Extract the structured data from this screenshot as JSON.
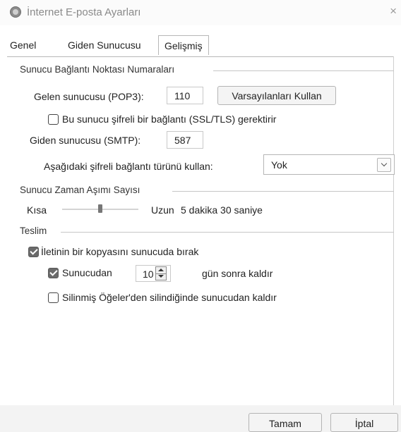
{
  "window": {
    "title": "İnternet E-posta Ayarları",
    "close_glyph": "×"
  },
  "tabs": [
    {
      "label": "Genel",
      "active": false
    },
    {
      "label": "Giden Sunucusu",
      "active": false
    },
    {
      "label": "Gelişmiş",
      "active": true
    }
  ],
  "ports": {
    "group_title": "Sunucu Bağlantı Noktası Numaraları",
    "incoming_label": "Gelen sunucusu (POP3):",
    "incoming_value": "110",
    "defaults_button": "Varsayılanları Kullan",
    "ssl_checkbox_label": "Bu sunucu şifreli bir bağlantı (SSL/TLS) gerektirir",
    "ssl_checked": false,
    "outgoing_label": "Giden sunucusu (SMTP):",
    "outgoing_value": "587",
    "encryption_label": "Aşağıdaki şifreli bağlantı türünü kullan:",
    "encryption_value": "Yok"
  },
  "timeout": {
    "group_title": "Sunucu Zaman Aşımı Sayısı",
    "short_label": "Kısa",
    "long_label": "Uzun",
    "value_text": "5 dakika 30 saniye",
    "slider_fraction": 0.5
  },
  "delivery": {
    "group_title": "Teslim",
    "leave_copy_label": "İletinin bir kopyasını sunucuda bırak",
    "leave_copy_checked": true,
    "remove_after_label": "Sunucudan",
    "remove_after_checked": true,
    "remove_after_days": "10",
    "remove_after_suffix": "gün sonra kaldır",
    "remove_deleted_label": "Silinmiş Öğeler'den silindiğinde sunucudan kaldır",
    "remove_deleted_checked": false
  },
  "footer": {
    "ok_label": "Tamam",
    "cancel_label": "İptal"
  }
}
